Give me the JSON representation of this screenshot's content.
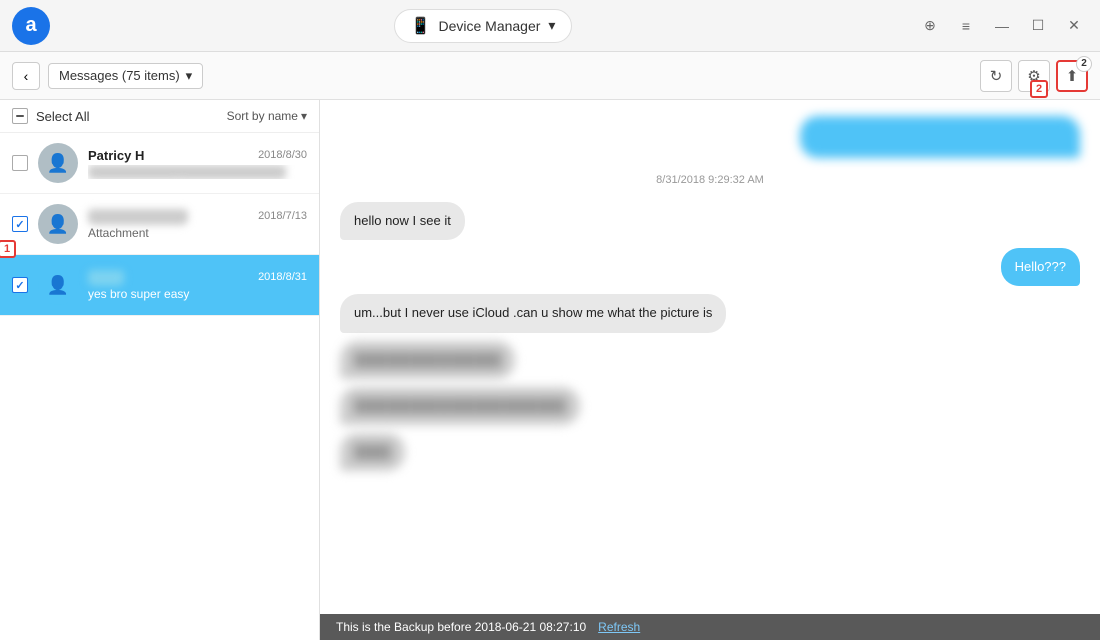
{
  "app": {
    "logo": "a",
    "title": "Device Manager",
    "device_icon": "📱",
    "dropdown_arrow": "▾"
  },
  "window_controls": {
    "search": "⊕",
    "menu": "≡",
    "minimize": "—",
    "maximize": "☐",
    "close": "✕"
  },
  "toolbar": {
    "back_arrow": "‹",
    "messages_label": "Messages (75 items)",
    "dropdown_arrow": "▾",
    "refresh_tooltip": "Refresh",
    "settings_tooltip": "Settings",
    "export_tooltip": "Export",
    "export_badge": "2"
  },
  "select_all": {
    "label": "Select All",
    "sort_label": "Sort by name",
    "sort_arrow": "▾"
  },
  "contacts": [
    {
      "name": "Patricy H",
      "date": "2018/8/30",
      "preview": "██████████ ████████",
      "avatar_initial": "👤",
      "selected": false,
      "checked": false,
      "blurred_preview": true
    },
    {
      "name": "██████████",
      "date": "2018/7/13",
      "preview": "Attachment",
      "avatar_initial": "👤",
      "selected": false,
      "checked": true,
      "blurred_name": true,
      "label_num": "1"
    },
    {
      "name": "███",
      "date": "2018/8/31",
      "preview": "yes bro super easy",
      "avatar_initial": "👤",
      "selected": true,
      "checked": true,
      "blurred_name": true
    }
  ],
  "chat": {
    "timestamp": "8/31/2018 9:29:32 AM",
    "messages": [
      {
        "type": "sent",
        "text": "██████████████████████████████████████",
        "blurred": true
      },
      {
        "type": "received",
        "text": "hello now I see it",
        "blurred": false
      },
      {
        "type": "sent",
        "text": "Hello???",
        "blurred": false
      },
      {
        "type": "received",
        "text": "um...but I never use iCloud .can u show me what the picture is",
        "blurred": false
      },
      {
        "type": "received",
        "text": "████████████████",
        "blurred": true
      },
      {
        "type": "received",
        "text": "███████████████████",
        "blurred": true
      },
      {
        "type": "received",
        "text": "███",
        "blurred": true
      }
    ]
  },
  "status_bar": {
    "message": "This is the Backup before 2018-06-21 08:27:10",
    "refresh_label": "Refresh"
  }
}
